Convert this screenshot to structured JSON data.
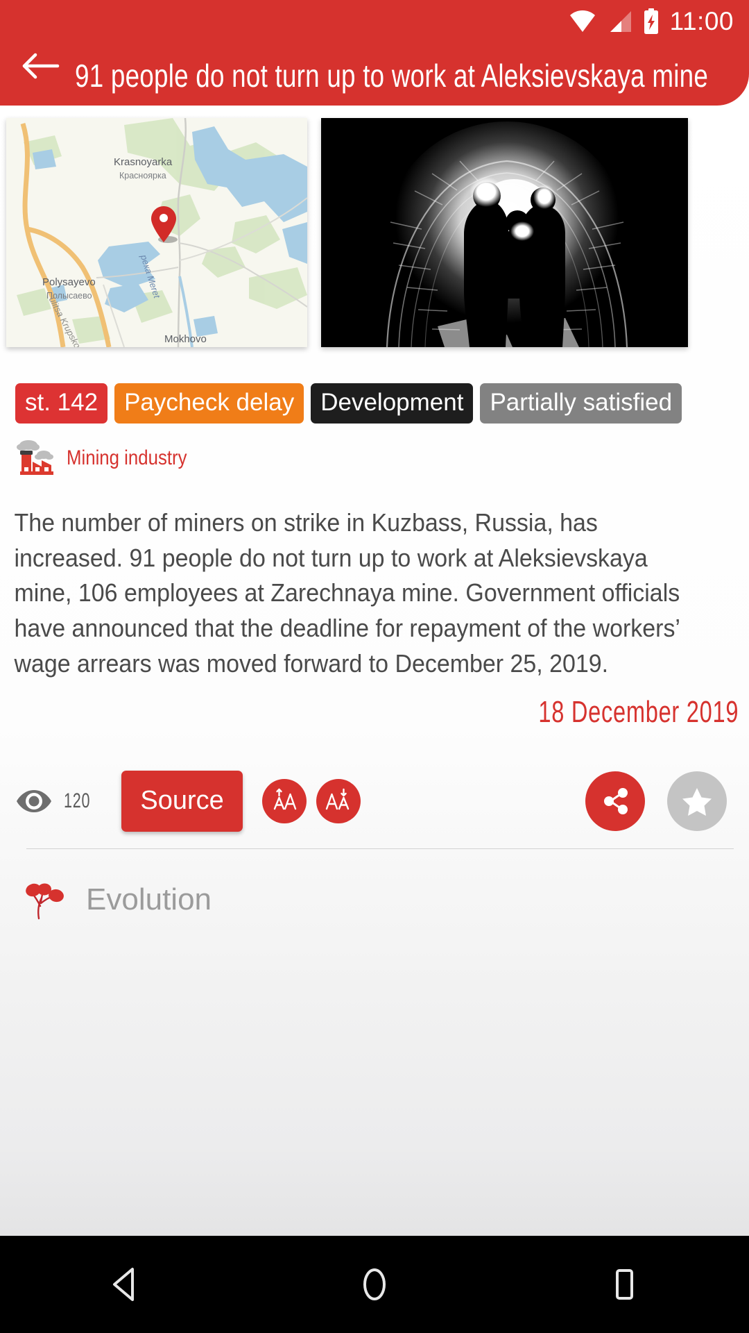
{
  "status_bar": {
    "time": "11:00",
    "icons": [
      "wifi-icon",
      "cellular-signal-icon",
      "battery-charging-icon"
    ]
  },
  "app_bar": {
    "back_icon": "arrow-left-icon",
    "title": "91 people do not turn up to work at Aleksievskaya mine",
    "background_color": "#d6322e"
  },
  "media": {
    "map": {
      "name": "location-map-thumbnail",
      "pin_icon": "map-pin-icon",
      "labels": [
        {
          "text": "Krasnoyarka",
          "sub": "Красноярка"
        },
        {
          "text": "Polysayevo",
          "sub": "Полысаево"
        },
        {
          "text": "Mokhovo",
          "sub": ""
        }
      ],
      "river_label": "река Meret",
      "street_label": "ulitsa Krupskoy"
    },
    "photo": {
      "name": "mine-tunnel-photo",
      "description": "Three miners with headlamps in a dark mine tunnel"
    }
  },
  "tags": [
    {
      "label": "st. 142",
      "color": "#dd3333",
      "style": "red"
    },
    {
      "label": "Paycheck delay",
      "color": "#f07d18",
      "style": "orange"
    },
    {
      "label": "Development",
      "color": "#1e1e1e",
      "style": "black"
    },
    {
      "label": "Partially satisfied",
      "color": "#828282",
      "style": "gray"
    }
  ],
  "industry": {
    "icon": "factory-icon",
    "label": "Mining industry",
    "color": "#d6322e"
  },
  "article": {
    "body": "The number of miners on strike in Kuzbass, Russia, has increased. 91 people do not turn up to work at Aleksievskaya mine, 106 employees at Zarechnaya mine. Government officials have announced that the deadline for repayment of the workers’ wage arrears was moved forward to December 25, 2019.",
    "date": "18 December 2019"
  },
  "actions": {
    "views_icon": "eye-icon",
    "views_count": "120",
    "source_label": "Source",
    "font_increase_icon": "font-size-increase-icon",
    "font_decrease_icon": "font-size-decrease-icon",
    "share_icon": "share-icon",
    "favorite_icon": "star-icon"
  },
  "evolution": {
    "icon": "evolution-branch-icon",
    "label": "Evolution"
  },
  "nav_bar": {
    "back": "nav-back-icon",
    "home": "nav-home-icon",
    "recents": "nav-recents-icon"
  },
  "colors": {
    "brand_red": "#d6322e",
    "accent_orange": "#f07d18",
    "neutral_gray": "#828282"
  }
}
